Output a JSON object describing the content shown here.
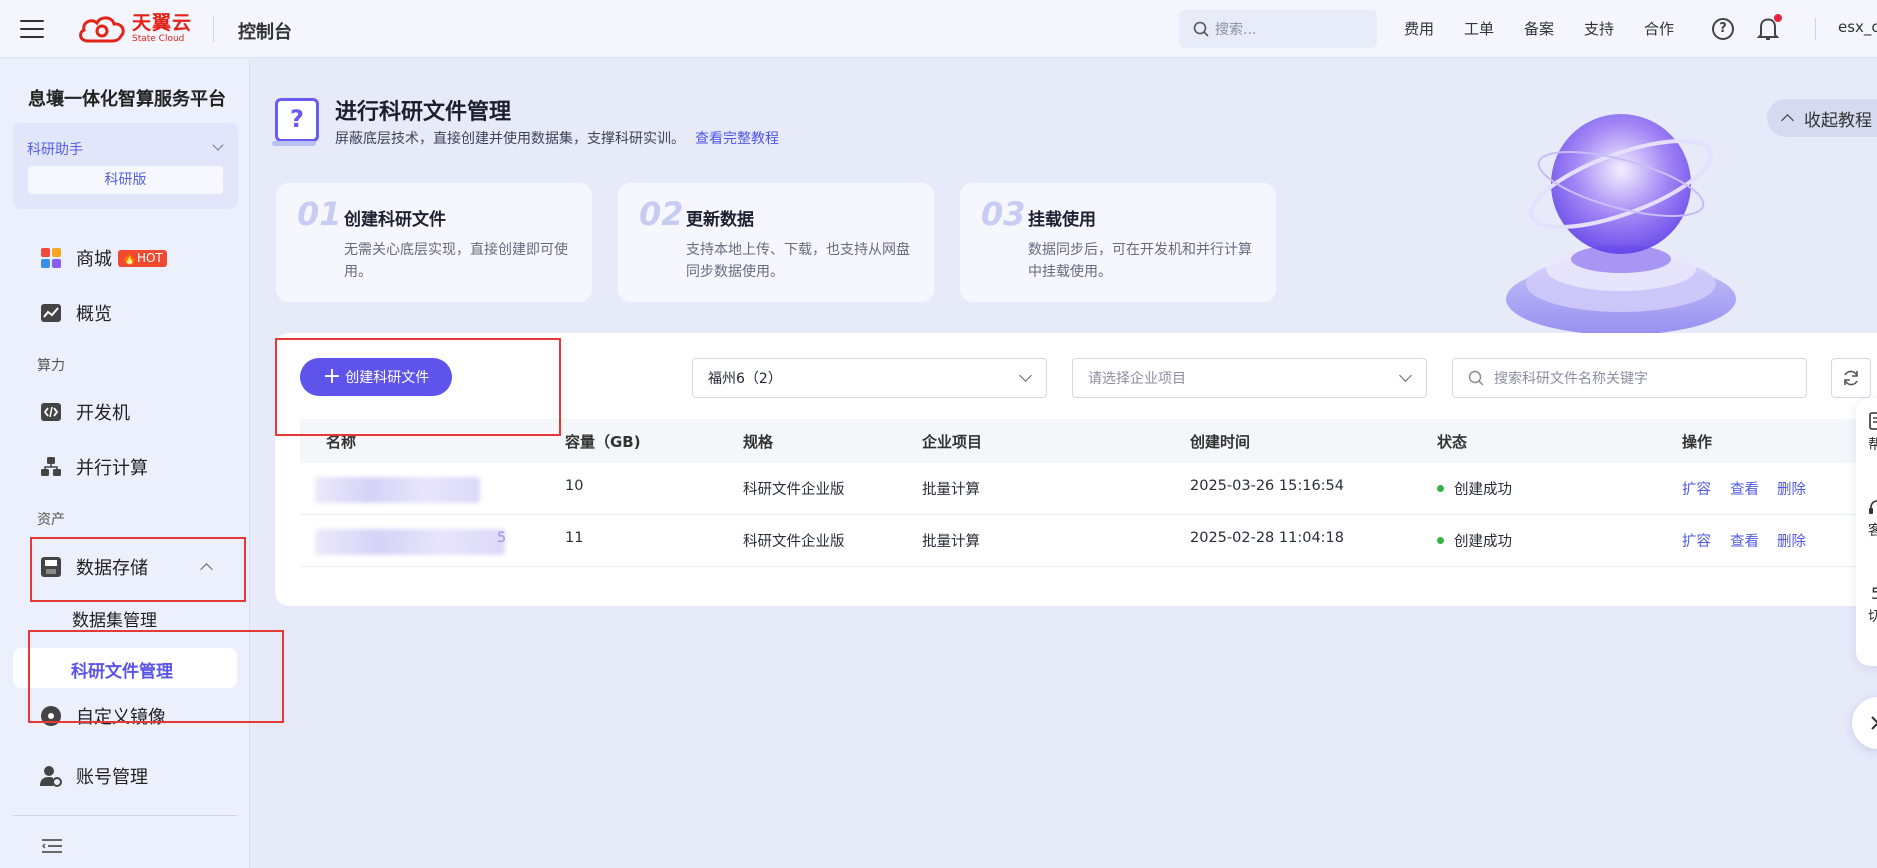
{
  "header": {
    "logo_cn": "天翼云",
    "logo_en": "State Cloud",
    "console": "控制台",
    "search_placeholder": "搜索...",
    "nav": [
      "费用",
      "工单",
      "备案",
      "支持",
      "合作"
    ],
    "user": "esx_c",
    "brand_color": "#e2231a"
  },
  "sidebar": {
    "platform_title": "息壤一体化智算服务平台",
    "assistant": {
      "label": "科研助手",
      "edition": "科研版"
    },
    "items": {
      "mall": {
        "label": "商城",
        "badge": "HOT"
      },
      "overview": {
        "label": "概览"
      },
      "group_compute": "算力",
      "devbox": {
        "label": "开发机"
      },
      "parallel": {
        "label": "并行计算"
      },
      "group_assets": "资产",
      "storage": {
        "label": "数据存储"
      },
      "dataset": {
        "label": "数据集管理"
      },
      "research_files": {
        "label": "科研文件管理"
      },
      "custom_image": {
        "label": "自定义镜像"
      },
      "account": {
        "label": "账号管理"
      }
    }
  },
  "main": {
    "title": "进行科研文件管理",
    "subtitle": "屏蔽底层技术，直接创建并使用数据集，支撑科研实训。",
    "tutorial_link": "查看完整教程",
    "collapse_btn": "收起教程",
    "steps": [
      {
        "num": "01",
        "title": "创建科研文件",
        "desc": "无需关心底层实现，直接创建即可使用。"
      },
      {
        "num": "02",
        "title": "更新数据",
        "desc": "支持本地上传、下载，也支持从网盘同步数据使用。"
      },
      {
        "num": "03",
        "title": "挂载使用",
        "desc": "数据同步后，可在开发机和并行计算中挂载使用。"
      }
    ],
    "create_button": "创建科研文件",
    "region_select": "福州6（2）",
    "project_placeholder": "请选择企业项目",
    "search_placeholder": "搜索科研文件名称关键字",
    "table": {
      "headers": [
        "名称",
        "容量（GB)",
        "规格",
        "企业项目",
        "创建时间",
        "状态",
        "操作"
      ],
      "rows": [
        {
          "capacity": "10",
          "spec": "科研文件企业版",
          "project": "批量计算",
          "created": "2025-03-26 15:16:54",
          "status": "创建成功"
        },
        {
          "capacity": "11",
          "spec": "科研文件企业版",
          "project": "批量计算",
          "created": "2025-02-28 11:04:18",
          "status": "创建成功"
        }
      ],
      "actions": [
        "扩容",
        "查看",
        "删除"
      ],
      "row2_name_tail": "5"
    },
    "float_panel": [
      "帮",
      "客",
      "切"
    ],
    "accent_color": "#5e54ec",
    "status_color": "#36b24a"
  }
}
